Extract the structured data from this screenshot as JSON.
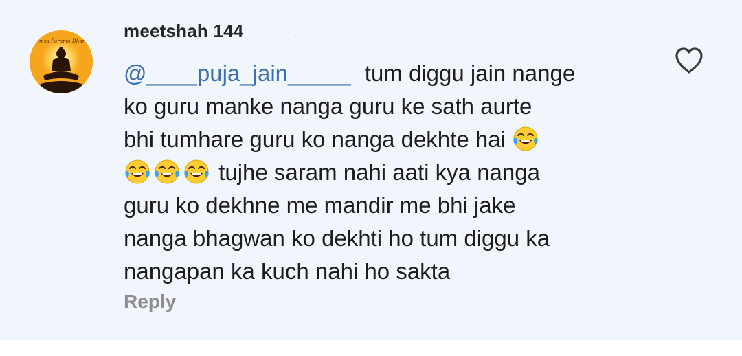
{
  "comment": {
    "username": "meetshah 144",
    "avatar_text": "imsa Paramo Dhar",
    "mention": "@____puja_jain_____",
    "lines": [
      "tum diggu jain nange",
      "ko guru manke nanga guru ke sath aurte",
      "bhi tumhare guru ko nanga dekhte hai",
      "tujhe saram nahi aati kya nanga",
      "guru ko dekhne me mandir me bhi jake",
      "nanga bhagwan ko dekhti ho tum diggu ka",
      "nangapan ka kuch nahi ho sakta"
    ],
    "reply_label": "Reply"
  },
  "icons": {
    "avatar": "meditating-figure-icon",
    "emoji": "face-with-tears-of-joy-icon",
    "like": "heart-outline-icon"
  },
  "colors": {
    "background": "#f1f6fd",
    "mention": "#3d6fb0",
    "text": "#1c1c1c",
    "reply": "#8e8e8e",
    "avatar": "#f6a51c"
  }
}
